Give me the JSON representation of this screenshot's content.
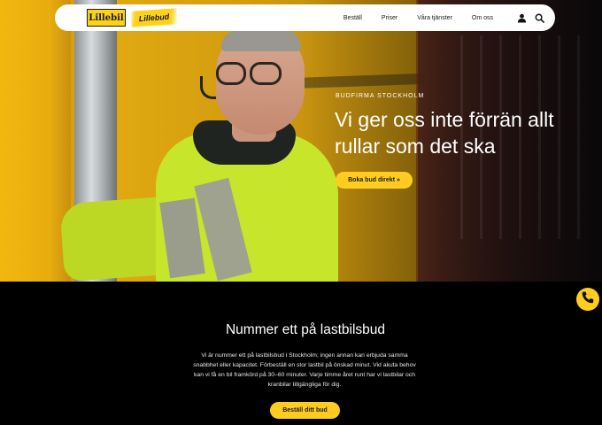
{
  "nav": {
    "logo_primary": "Lillebil",
    "logo_secondary": "Lillebud",
    "links": [
      {
        "label": "Beställ"
      },
      {
        "label": "Priser"
      },
      {
        "label": "Våra tjänster"
      },
      {
        "label": "Om oss"
      }
    ],
    "icons": [
      "user-icon",
      "search-icon"
    ]
  },
  "hero": {
    "kicker": "BUDFIRMA STOCKHOLM",
    "heading": "Vi ger oss inte förrän allt rullar som det ska",
    "cta_label": "Boka bud direkt »"
  },
  "section": {
    "heading": "Nummer ett på lastbilsbud",
    "body": "Vi är nummer ett på lastbilsbud i Stockholm; ingen annan kan erbjuda samma snabbhet eller kapacitet. Förbeställ en stor lastbil på önskad minut. Vid akuta behov kan vi få en bil framkörd på 30–60 minuter. Varje timme året runt har vi lastbilar och kranbilar tillgängliga för dig.",
    "cta_label": "Beställ ditt bud"
  },
  "fab": {
    "icon": "phone-icon"
  },
  "colors": {
    "accent": "#ffcc1f",
    "background": "#000000",
    "nav_bg": "#ffffff"
  }
}
